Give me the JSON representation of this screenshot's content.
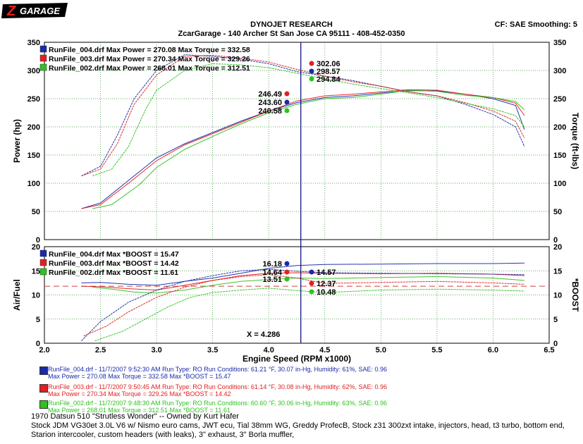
{
  "header": {
    "logo_letter": "Z",
    "logo_text": "GARAGE",
    "title": "DYNOJET RESEARCH",
    "subtitle": "ZcarGarage - 140 Archer St San Jose CA 95111 - 408-452-0350",
    "cf": "CF: SAE  Smoothing: 5"
  },
  "colors": {
    "run004": "#1a2aa8",
    "run003": "#e02020",
    "run002": "#30c020",
    "cursor": "#00007a"
  },
  "chart_data": [
    {
      "type": "line",
      "ylabel": "Power (hp)",
      "ylabel_right": "Torque (ft-lbs)",
      "xlim": [
        2.0,
        6.5
      ],
      "ylim": [
        0,
        350
      ],
      "yticks": [
        0,
        50,
        100,
        150,
        200,
        250,
        300,
        350
      ],
      "legend": [
        "RunFile_004.drf Max Power = 270.08    Max Torque = 332.58",
        "RunFile_003.drf Max Power = 270.34    Max Torque = 329.26",
        "RunFile_002.drf Max Power = 268.01    Max Torque = 312.51"
      ],
      "cursor_values": {
        "power": [
          "246.49",
          "243.60",
          "240.58"
        ],
        "torque": [
          "302.06",
          "298.57",
          "294.84"
        ]
      },
      "series": [
        {
          "name": "RunFile_004.drf Power",
          "color": "#1a2aa8",
          "x": [
            2.33,
            2.5,
            2.75,
            3.0,
            3.25,
            3.5,
            3.75,
            4.0,
            4.25,
            4.5,
            4.75,
            5.0,
            5.25,
            5.5,
            5.75,
            6.0,
            6.2,
            6.28
          ],
          "y": [
            55,
            65,
            105,
            145,
            170,
            190,
            210,
            228,
            243,
            252,
            255,
            260,
            264,
            264,
            258,
            250,
            238,
            195
          ]
        },
        {
          "name": "RunFile_003.drf Power",
          "color": "#e02020",
          "x": [
            2.33,
            2.5,
            2.75,
            3.0,
            3.25,
            3.5,
            3.75,
            4.0,
            4.25,
            4.5,
            4.75,
            5.0,
            5.25,
            5.5,
            5.75,
            6.0,
            6.2,
            6.28
          ],
          "y": [
            55,
            62,
            100,
            140,
            168,
            188,
            208,
            228,
            246,
            255,
            258,
            262,
            266,
            265,
            258,
            252,
            242,
            220
          ]
        },
        {
          "name": "RunFile_002.drf Power",
          "color": "#30c020",
          "x": [
            2.43,
            2.6,
            2.85,
            3.0,
            3.25,
            3.5,
            3.75,
            4.0,
            4.25,
            4.5,
            4.75,
            5.0,
            5.25,
            5.5,
            5.75,
            6.0,
            6.2,
            6.28
          ],
          "y": [
            55,
            62,
            98,
            128,
            160,
            183,
            205,
            225,
            240,
            250,
            252,
            258,
            265,
            263,
            256,
            252,
            245,
            230
          ]
        },
        {
          "name": "RunFile_004.drf Torque",
          "color": "#1a2aa8",
          "x": [
            2.33,
            2.5,
            2.65,
            2.8,
            3.0,
            3.25,
            3.5,
            3.75,
            4.0,
            4.25,
            4.5,
            4.75,
            5.0,
            5.25,
            5.5,
            5.75,
            6.0,
            6.2,
            6.28
          ],
          "y": [
            113,
            130,
            185,
            250,
            300,
            328,
            325,
            320,
            312,
            298,
            290,
            282,
            272,
            262,
            255,
            240,
            222,
            200,
            165
          ]
        },
        {
          "name": "RunFile_003.drf Torque",
          "color": "#e02020",
          "x": [
            2.33,
            2.5,
            2.65,
            2.8,
            3.0,
            3.25,
            3.5,
            3.75,
            4.0,
            4.25,
            4.5,
            4.75,
            5.0,
            5.25,
            5.5,
            5.75,
            6.0,
            6.2,
            6.28
          ],
          "y": [
            113,
            125,
            170,
            240,
            292,
            325,
            327,
            322,
            315,
            302,
            290,
            280,
            272,
            262,
            255,
            243,
            228,
            210,
            180
          ]
        },
        {
          "name": "RunFile_002.drf Torque",
          "color": "#30c020",
          "x": [
            2.43,
            2.6,
            2.75,
            2.9,
            3.0,
            3.25,
            3.5,
            3.75,
            4.0,
            4.25,
            4.5,
            4.75,
            5.0,
            5.25,
            5.5,
            5.75,
            6.0,
            6.2,
            6.28
          ],
          "y": [
            113,
            125,
            165,
            230,
            265,
            300,
            312,
            310,
            305,
            295,
            285,
            276,
            268,
            260,
            252,
            242,
            232,
            220,
            200
          ]
        }
      ]
    },
    {
      "type": "line",
      "xlabel": "Engine Speed (RPM x1000)",
      "ylabel": "Air/Fuel",
      "ylabel_right": "*BOOST",
      "xlim": [
        2.0,
        6.5
      ],
      "ylim": [
        0,
        20
      ],
      "yticks": [
        0,
        5,
        10,
        15,
        20
      ],
      "xticks": [
        "2.0",
        "2.5",
        "3.0",
        "3.5",
        "4.0",
        "4.5",
        "5.0",
        "5.5",
        "6.0",
        "6.5"
      ],
      "cursor_label": "X = 4.286",
      "cursor_x": 4.286,
      "reference_y": 11.8,
      "legend": [
        "RunFile_004.drf Max *BOOST = 15.47",
        "RunFile_003.drf Max *BOOST = 14.42",
        "RunFile_002.drf Max *BOOST = 11.61"
      ],
      "cursor_values": {
        "left": [
          "16.18",
          "14.64",
          "13.51"
        ],
        "right": [
          "14.57",
          "12.37",
          "10.48"
        ]
      },
      "series": [
        {
          "name": "RunFile_004.drf Air/Fuel",
          "color": "#1a2aa8",
          "x": [
            2.33,
            2.5,
            2.75,
            3.0,
            3.25,
            3.5,
            3.75,
            4.0,
            4.25,
            4.5,
            5.0,
            5.5,
            6.0,
            6.28
          ],
          "y": [
            12.5,
            12.6,
            12.2,
            12.0,
            12.8,
            13.5,
            14.5,
            15.5,
            16.1,
            16.3,
            16.4,
            16.5,
            16.5,
            16.6
          ]
        },
        {
          "name": "RunFile_003.drf Air/Fuel",
          "color": "#e02020",
          "x": [
            2.33,
            2.5,
            2.75,
            3.0,
            3.25,
            3.5,
            3.75,
            4.0,
            4.25,
            4.5,
            5.0,
            5.5,
            6.0,
            6.28
          ],
          "y": [
            11.8,
            11.7,
            11.3,
            11.0,
            12.0,
            13.0,
            14.0,
            14.5,
            14.6,
            14.5,
            14.4,
            14.5,
            14.3,
            14.0
          ]
        },
        {
          "name": "RunFile_002.drf Air/Fuel",
          "color": "#30c020",
          "x": [
            2.43,
            2.6,
            2.8,
            3.0,
            3.25,
            3.5,
            3.75,
            4.0,
            4.25,
            4.5,
            5.0,
            5.5,
            6.0,
            6.28
          ],
          "y": [
            11.6,
            11.2,
            10.6,
            10.4,
            11.0,
            12.0,
            12.8,
            13.2,
            13.5,
            13.4,
            13.6,
            13.8,
            13.5,
            13.0
          ]
        },
        {
          "name": "RunFile_004.drf *BOOST",
          "color": "#1a2aa8",
          "x": [
            2.33,
            2.5,
            2.75,
            3.0,
            3.25,
            3.5,
            3.75,
            4.0,
            4.25,
            4.5,
            5.0,
            5.5,
            6.0,
            6.28
          ],
          "y": [
            0.5,
            4.5,
            8.5,
            11.0,
            12.8,
            14.0,
            15.0,
            15.3,
            14.9,
            14.6,
            14.5,
            14.4,
            14.3,
            14.2
          ]
        },
        {
          "name": "RunFile_003.drf *BOOST",
          "color": "#e02020",
          "x": [
            2.35,
            2.55,
            2.75,
            3.0,
            3.25,
            3.5,
            3.75,
            4.0,
            4.25,
            4.5,
            5.0,
            5.5,
            6.0,
            6.28
          ],
          "y": [
            1.5,
            3.5,
            6.5,
            9.5,
            11.6,
            13.0,
            13.8,
            14.2,
            13.5,
            12.4,
            12.6,
            12.8,
            12.5,
            12.2
          ]
        },
        {
          "name": "RunFile_002.drf *BOOST",
          "color": "#30c020",
          "x": [
            2.45,
            2.7,
            2.9,
            3.1,
            3.3,
            3.5,
            3.75,
            4.0,
            4.25,
            4.5,
            5.0,
            5.5,
            6.0,
            6.28
          ],
          "y": [
            0.5,
            2.5,
            5.0,
            7.5,
            9.5,
            10.5,
            11.0,
            11.4,
            10.9,
            10.5,
            11.0,
            11.2,
            11.0,
            10.8
          ]
        }
      ]
    }
  ],
  "run_info": [
    {
      "line1": "RunFile_004.drf - 11/7/2007 9:52:30 AM  Run Type: RO  Run Conditions: 61.21 °F, 30.07 in-Hg,  Humidity:  61%,  SAE: 0.96",
      "line2": "Max Power = 270.08  Max Torque = 332.58  Max *BOOST = 15.47",
      "color": "#1a2aa8"
    },
    {
      "line1": "RunFile_003.drf - 11/7/2007 9:50:45 AM  Run Type: RO  Run Conditions: 61.14 °F, 30.08 in-Hg,  Humidity:  62%,  SAE: 0.96",
      "line2": "Max Power = 270.34  Max Torque = 329.26  Max *BOOST = 14.42",
      "color": "#e02020"
    },
    {
      "line1": "RunFile_002.drf - 11/7/2007 9:48:30 AM  Run Type: RO  Run Conditions: 60.60 °F, 30.06 in-Hg,  Humidity:  63%,  SAE: 0.96",
      "line2": "Max Power = 268.01  Max Torque = 312.51  Max *BOOST = 11.61",
      "color": "#30c020"
    }
  ],
  "car": {
    "line1": "1970 Datsun 510 \"Strutless Wonder\" -- Owned by Kurt Hafer",
    "line2": "Stock JDM VG30et 3.0L V6 w/ Nismo euro cams, JWT ecu, Tial 38mm WG, Greddy ProfecB, Stock z31 300zxt intake, injectors, head, t3 turbo, bottom end,",
    "line3": "Starion intercooler, custom headers (with leaks), 3\" exhaust, 3\" Borla muffler,"
  }
}
